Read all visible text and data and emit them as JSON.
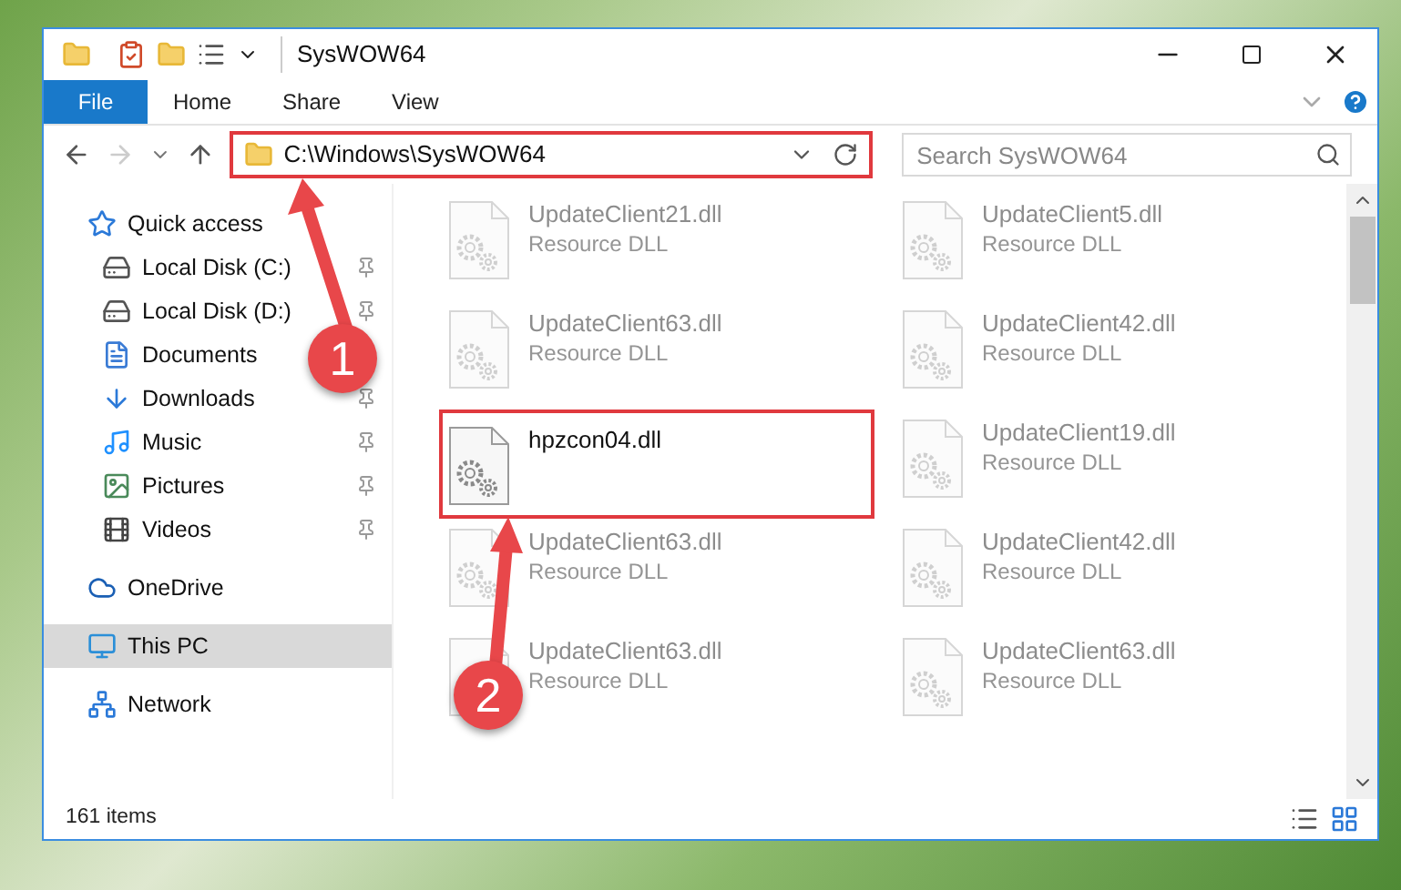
{
  "window": {
    "title": "SysWOW64"
  },
  "ribbon_tabs": [
    {
      "label": "File",
      "kind": "file"
    },
    {
      "label": "Home",
      "kind": "tab"
    },
    {
      "label": "Share",
      "kind": "tab"
    },
    {
      "label": "View",
      "kind": "tab"
    }
  ],
  "address": {
    "path": "C:\\Windows\\SysWOW64",
    "highlighted": true
  },
  "search": {
    "placeholder": "Search SysWOW64"
  },
  "nav": [
    {
      "label": "Quick access",
      "selected": false,
      "children": [
        {
          "label": "Local Disk (C:)",
          "pinned": true,
          "selected": false
        },
        {
          "label": "Local Disk (D:)",
          "pinned": true,
          "selected": false
        },
        {
          "label": "Documents",
          "selected": false
        },
        {
          "label": "Downloads",
          "pinned": true,
          "selected": false
        },
        {
          "label": "Music",
          "pinned": true,
          "selected": false
        },
        {
          "label": "Pictures",
          "pinned": true,
          "selected": false
        },
        {
          "label": "Videos",
          "pinned": true,
          "selected": false
        }
      ]
    },
    {
      "label": "OneDrive",
      "selected": false
    },
    {
      "label": "This PC",
      "selected": true
    },
    {
      "label": "Network",
      "selected": false
    }
  ],
  "files": [
    {
      "name": "UpdateClient21.dll",
      "type": "Resource DLL",
      "blurred": true,
      "highlighted": false
    },
    {
      "name": "UpdateClient5.dll",
      "type": "Resource DLL",
      "blurred": true,
      "highlighted": false
    },
    {
      "name": "UpdateClient63.dll",
      "type": "Resource DLL",
      "blurred": true,
      "highlighted": false
    },
    {
      "name": "UpdateClient42.dll",
      "type": "Resource DLL",
      "blurred": true,
      "highlighted": false
    },
    {
      "name": "hpzcon04.dll",
      "blurred": false,
      "highlighted": true
    },
    {
      "name": "UpdateClient19.dll",
      "type": "Resource DLL",
      "blurred": true,
      "highlighted": false
    },
    {
      "name": "UpdateClient63.dll",
      "type": "Resource DLL",
      "blurred": true,
      "highlighted": false
    },
    {
      "name": "UpdateClient42.dll",
      "type": "Resource DLL",
      "blurred": true,
      "highlighted": false
    },
    {
      "name": "UpdateClient63.dll",
      "type": "Resource DLL",
      "blurred": true,
      "highlighted": false
    },
    {
      "name": "UpdateClient63.dll",
      "type": "Resource DLL",
      "blurred": true,
      "highlighted": false
    }
  ],
  "status_bar": {
    "count": "161 items"
  },
  "callouts": [
    {
      "label": "1"
    },
    {
      "label": "2"
    }
  ]
}
